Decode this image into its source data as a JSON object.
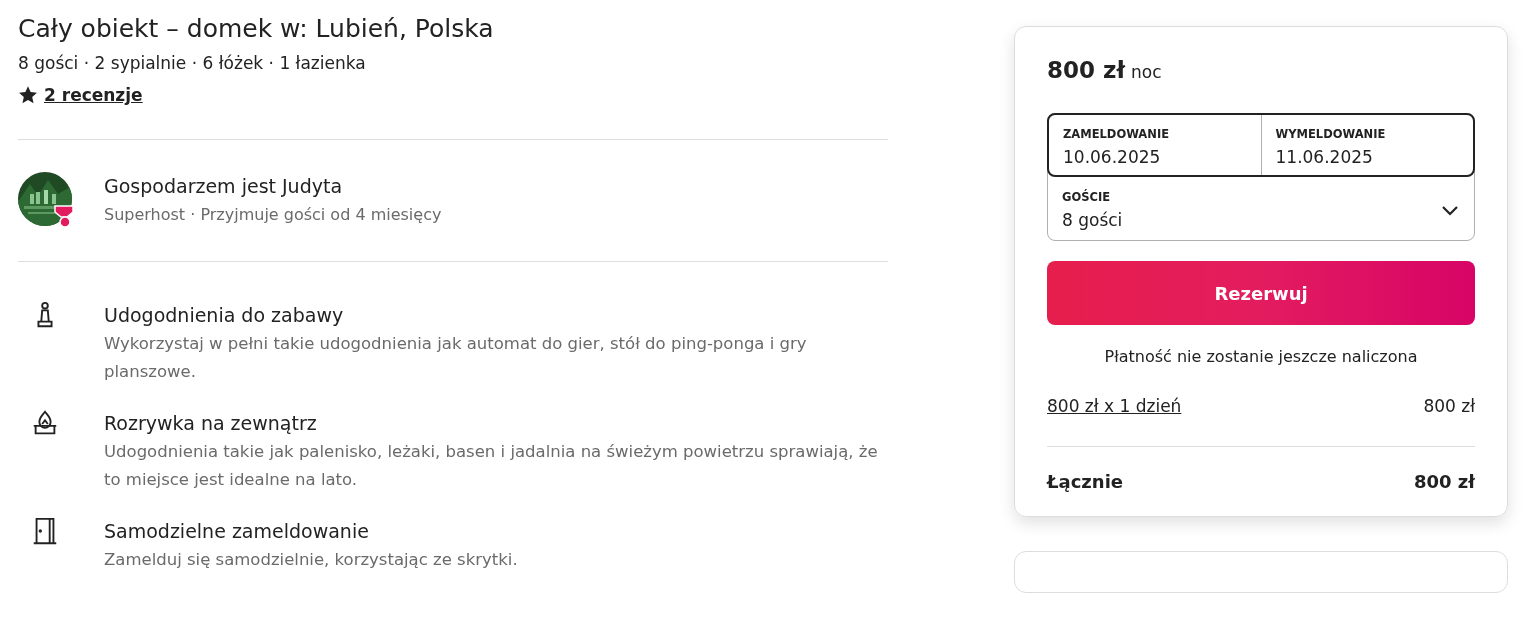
{
  "listing": {
    "title": "Cały obiekt – domek w: Lubień, Polska",
    "summary": "8 gości · 2 sypialnie · 6 łóżek · 1 łazienka",
    "reviews": "2 recenzje"
  },
  "host": {
    "name": "Gospodarzem jest Judyta",
    "details": "Superhost · Przyjmuje gości od 4 miesięcy",
    "superhost": true
  },
  "features": [
    {
      "kind": "chess",
      "title": "Udogodnienia do zabawy",
      "description": "Wykorzystaj w pełni takie udogodnienia jak automat do gier, stół do ping-ponga i gry planszowe."
    },
    {
      "kind": "fire",
      "title": "Rozrywka na zewnątrz",
      "description": "Udogodnienia takie jak palenisko, leżaki, basen i jadalnia na świeżym powietrzu sprawiają, że to miejsce jest idealne na lato."
    },
    {
      "kind": "door",
      "title": "Samodzielne zameldowanie",
      "description": "Zamelduj się samodzielnie, korzystając ze skrytki."
    }
  ],
  "booking": {
    "price": "800 zł",
    "unit": "noc",
    "checkin_label": "ZAMELDOWANIE",
    "checkin": "10.06.2025",
    "checkout_label": "WYMELDOWANIE",
    "checkout": "11.06.2025",
    "guests_label": "GOŚCIE",
    "guests": "8 gości",
    "reserve": "Rezerwuj",
    "note": "Płatność nie zostanie jeszcze naliczona",
    "lines": [
      {
        "label": "800 zł x 1 dzień",
        "amount": "800 zł"
      }
    ],
    "total_label": "Łącznie",
    "total": "800 zł"
  }
}
